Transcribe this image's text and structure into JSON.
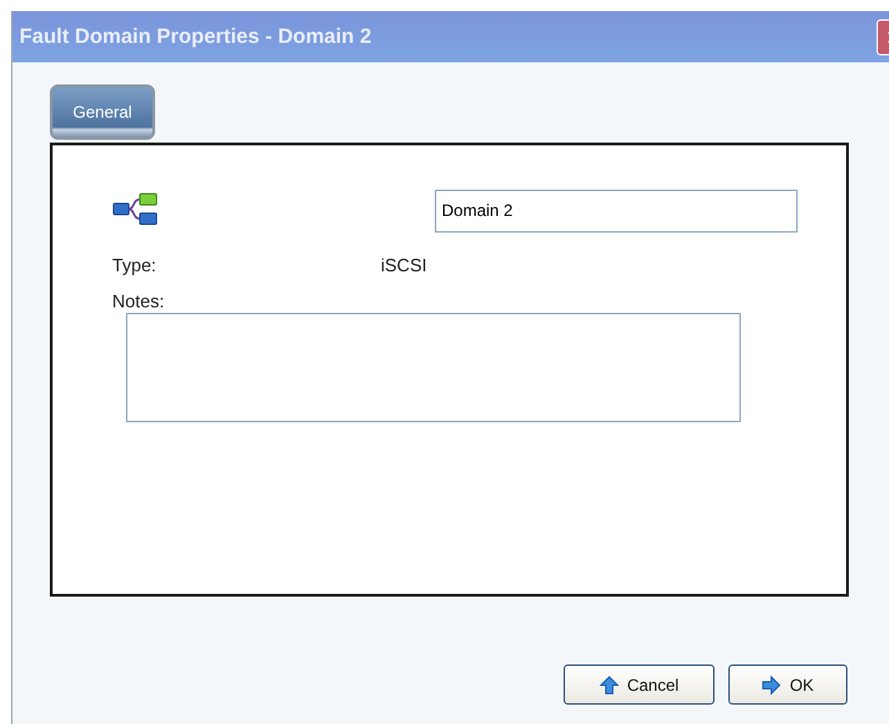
{
  "window": {
    "title": "Fault Domain Properties - Domain 2"
  },
  "tabs": [
    {
      "label": "General",
      "selected": true
    }
  ],
  "form": {
    "name_value": "Domain 2",
    "type_label": "Type:",
    "type_value": "iSCSI",
    "notes_label": "Notes:"
  },
  "buttons": [
    {
      "label": "Cancel",
      "kind": "cancel"
    },
    {
      "label": "OK",
      "kind": "ok"
    }
  ]
}
